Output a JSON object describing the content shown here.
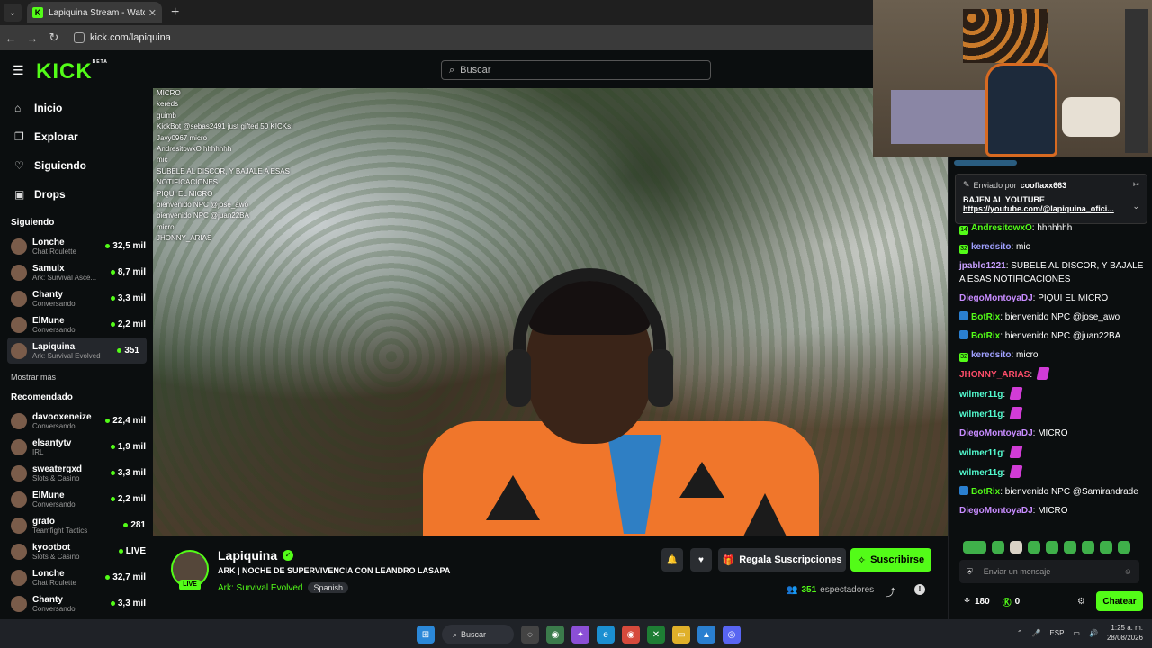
{
  "browser": {
    "tab_title": "Lapiquina Stream - Watch Live o",
    "url": "kick.com/lapiquina"
  },
  "header": {
    "logo": "KICK",
    "logo_badge": "BETA",
    "search_placeholder": "Buscar"
  },
  "nav": {
    "items": [
      {
        "label": "Inicio",
        "icon": "home-icon"
      },
      {
        "label": "Explorar",
        "icon": "explore-icon"
      },
      {
        "label": "Siguiendo",
        "icon": "heart-icon"
      },
      {
        "label": "Drops",
        "icon": "gift-icon"
      }
    ]
  },
  "following": {
    "title": "Siguiendo",
    "channels": [
      {
        "name": "Lonche",
        "category": "Chat Roulette",
        "viewers": "32,5 mil"
      },
      {
        "name": "Samulx",
        "category": "Ark: Survival Asce...",
        "viewers": "8,7 mil"
      },
      {
        "name": "Chanty",
        "category": "Conversando",
        "viewers": "3,3 mil"
      },
      {
        "name": "ElMune",
        "category": "Conversando",
        "viewers": "2,2 mil"
      },
      {
        "name": "Lapiquina",
        "category": "Ark: Survival Evolved",
        "viewers": "351"
      }
    ],
    "more": "Mostrar más"
  },
  "recommended": {
    "title": "Recomendado",
    "channels": [
      {
        "name": "davooxeneize",
        "category": "Conversando",
        "viewers": "22,4 mil"
      },
      {
        "name": "elsantytv",
        "category": "IRL",
        "viewers": "1,9 mil"
      },
      {
        "name": "sweatergxd",
        "category": "Slots & Casino",
        "viewers": "3,3 mil"
      },
      {
        "name": "ElMune",
        "category": "Conversando",
        "viewers": "2,2 mil"
      },
      {
        "name": "grafo",
        "category": "Teamfight Tactics",
        "viewers": "281"
      },
      {
        "name": "kyootbot",
        "category": "Slots & Casino",
        "viewers": "LIVE"
      },
      {
        "name": "Lonche",
        "category": "Chat Roulette",
        "viewers": "32,7 mil"
      },
      {
        "name": "Chanty",
        "category": "Conversando",
        "viewers": "3,3 mil"
      }
    ]
  },
  "overlay_chat": [
    "MICRO",
    "kereds",
    "guimb",
    "KickBot @sebas2491 just gifted 50 KICKs!",
    "Javy0967 micro",
    "AndresitowxO hhhhhhh",
    "mic",
    "SUBELE AL DISCOR, Y BAJALE A ESAS",
    "NOTIFICACIONES",
    "PIQUI EL MICRO",
    "bienvenido NPC @jose_awo",
    "bienvenido NPC @juan22BA",
    "micro",
    "JHONNY_ARIAS"
  ],
  "stream": {
    "streamer": "Lapiquina",
    "live_label": "LIVE",
    "title": "ARK | NOCHE DE SUPERVIVENCIA CON LEANDRO LASAPA",
    "category": "Ark: Survival Evolved",
    "language": "Spanish",
    "gift_label": "Regala Suscripciones",
    "subscribe_label": "Suscribirse",
    "viewers": "351",
    "viewers_label": "espectadores"
  },
  "chat": {
    "pinned_sender_label": "Enviado por",
    "pinned_sender": "cooflaxx663",
    "pinned_message": "BAJEN AL YOUTUBE",
    "pinned_link": "https://youtube.com/@lapiquina_ofici...",
    "messages": [
      {
        "user": "AndresitowxO",
        "text": "hhhhhhh",
        "color": "#53fc18",
        "badge": "14"
      },
      {
        "user": "keredsito",
        "text": "mic",
        "color": "#a0a0ff",
        "badge": "32"
      },
      {
        "user": "jpablo1221",
        "text": "SUBELE AL DISCOR, Y BAJALE A ESAS NOTIFICACIONES",
        "color": "#c8a0ff",
        "badge": ""
      },
      {
        "user": "DiegoMontoyaDJ",
        "text": "PIQUI EL MICRO",
        "color": "#c88cff",
        "badge": ""
      },
      {
        "user": "BotRix",
        "text": "bienvenido NPC @jose_awo",
        "color": "#53fc18",
        "badge": "bot"
      },
      {
        "user": "BotRix",
        "text": "bienvenido NPC @juan22BA",
        "color": "#53fc18",
        "badge": "bot"
      },
      {
        "user": "keredsito",
        "text": "micro",
        "color": "#a0a0ff",
        "badge": "32"
      },
      {
        "user": "JHONNY_ARIAS",
        "text": "",
        "color": "#ff4d6a",
        "badge": "",
        "emote": true
      },
      {
        "user": "wilmer11g",
        "text": "",
        "color": "#53fcd0",
        "badge": "",
        "emote": true
      },
      {
        "user": "wilmer11g",
        "text": "",
        "color": "#53fcd0",
        "badge": "",
        "emote": true
      },
      {
        "user": "DiegoMontoyaDJ",
        "text": "MICRO",
        "color": "#c88cff",
        "badge": ""
      },
      {
        "user": "wilmer11g",
        "text": "",
        "color": "#53fcd0",
        "badge": "",
        "emote": true
      },
      {
        "user": "wilmer11g",
        "text": "",
        "color": "#53fcd0",
        "badge": "",
        "emote": true
      },
      {
        "user": "BotRix",
        "text": "bienvenido NPC @Samirandrade",
        "color": "#53fc18",
        "badge": "bot"
      },
      {
        "user": "DiegoMontoyaDJ",
        "text": "MICRO",
        "color": "#c88cff",
        "badge": ""
      }
    ],
    "input_placeholder": "Enviar un mensaje",
    "points": "180",
    "kicks": "0",
    "send_label": "Chatear"
  },
  "taskbar": {
    "search_label": "Buscar",
    "lang": "ESP",
    "time": "1:25 a. m.",
    "date": "28/08/2026"
  },
  "colors": {
    "accent": "#53fc18",
    "background": "#0b0e0f"
  }
}
